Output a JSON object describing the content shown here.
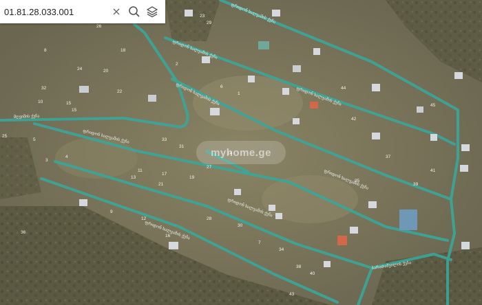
{
  "search": {
    "value": "01.81.28.033.001",
    "clear_icon": "close-icon",
    "search_icon": "magnifier-icon",
    "layers_icon": "layers-icon"
  },
  "watermark": {
    "text": "myhome.ge"
  },
  "colors": {
    "road": "#3aa79a",
    "road_label": "#e8efe8",
    "parcel_number": "#f4f4ec",
    "imagery_base": "#6f6a55"
  },
  "road_labels": [
    "მღვიმის ქუჩა",
    "ფრიდონ ხალვაშის ქუჩა",
    "ფრიდონ ხალვაშის ქუჩა",
    "ფრიდონ ხალვაშის ქუჩა",
    "ფრიდონ ხალვაშის ქუჩა",
    "ფრიდონ ხალვაშის ქუჩა",
    "ფრიდონ ხალვაშის ქუჩა",
    "ფრიდონ ხალვაშის ქუჩა",
    "ფრიდონ ხალვაშის ქუჩა",
    "ბარათაშვილის ქუჩა"
  ],
  "parcel_numbers": [
    "8",
    "15",
    "15",
    "10",
    "32",
    "24",
    "20",
    "18",
    "26",
    "22",
    "25",
    "23",
    "29",
    "5",
    "3",
    "4",
    "33",
    "31",
    "11",
    "21",
    "13",
    "17",
    "19",
    "27",
    "14",
    "9",
    "12",
    "16",
    "28",
    "30",
    "7",
    "2",
    "6",
    "1",
    "36",
    "34",
    "38",
    "40",
    "35",
    "37",
    "39",
    "41",
    "42",
    "43",
    "44",
    "45"
  ]
}
